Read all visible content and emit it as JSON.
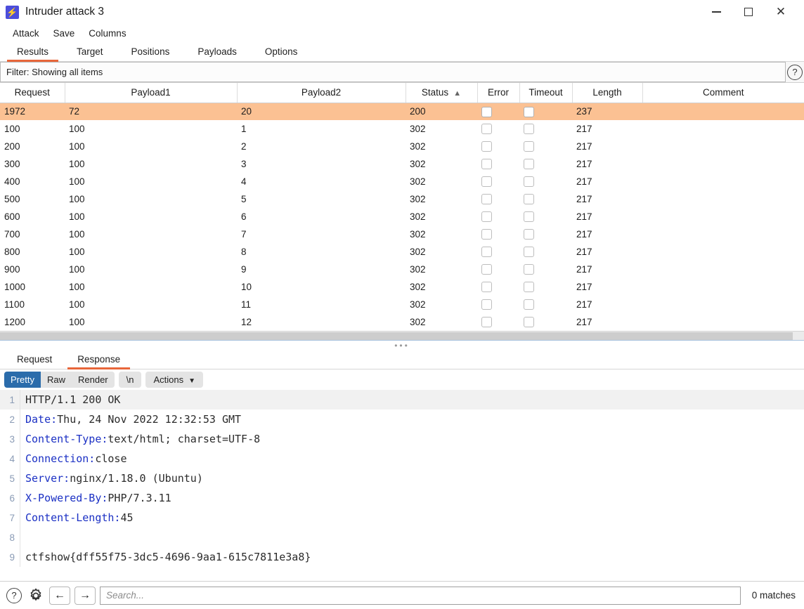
{
  "window": {
    "title": "Intruder attack 3",
    "app_icon": "lightning-bolt-icon",
    "minimize": "minimize-icon",
    "maximize": "maximize-icon",
    "close": "close-icon"
  },
  "menubar": {
    "items": [
      "Attack",
      "Save",
      "Columns"
    ]
  },
  "tabs": {
    "items": [
      "Results",
      "Target",
      "Positions",
      "Payloads",
      "Options"
    ],
    "active": "Results"
  },
  "filter": {
    "text": "Filter: Showing all items",
    "help_icon": "question-circle-icon"
  },
  "table": {
    "columns": [
      "Request",
      "Payload1",
      "Payload2",
      "Status",
      "Error",
      "Timeout",
      "Length",
      "Comment"
    ],
    "sorted_column": "Status",
    "sort_direction": "ascending",
    "rows": [
      {
        "request": "1972",
        "payload1": "72",
        "payload2": "20",
        "status": "200",
        "error": false,
        "timeout": false,
        "length": "237",
        "comment": "",
        "selected": true
      },
      {
        "request": "100",
        "payload1": "100",
        "payload2": "1",
        "status": "302",
        "error": false,
        "timeout": false,
        "length": "217",
        "comment": "",
        "selected": false
      },
      {
        "request": "200",
        "payload1": "100",
        "payload2": "2",
        "status": "302",
        "error": false,
        "timeout": false,
        "length": "217",
        "comment": "",
        "selected": false
      },
      {
        "request": "300",
        "payload1": "100",
        "payload2": "3",
        "status": "302",
        "error": false,
        "timeout": false,
        "length": "217",
        "comment": "",
        "selected": false
      },
      {
        "request": "400",
        "payload1": "100",
        "payload2": "4",
        "status": "302",
        "error": false,
        "timeout": false,
        "length": "217",
        "comment": "",
        "selected": false
      },
      {
        "request": "500",
        "payload1": "100",
        "payload2": "5",
        "status": "302",
        "error": false,
        "timeout": false,
        "length": "217",
        "comment": "",
        "selected": false
      },
      {
        "request": "600",
        "payload1": "100",
        "payload2": "6",
        "status": "302",
        "error": false,
        "timeout": false,
        "length": "217",
        "comment": "",
        "selected": false
      },
      {
        "request": "700",
        "payload1": "100",
        "payload2": "7",
        "status": "302",
        "error": false,
        "timeout": false,
        "length": "217",
        "comment": "",
        "selected": false
      },
      {
        "request": "800",
        "payload1": "100",
        "payload2": "8",
        "status": "302",
        "error": false,
        "timeout": false,
        "length": "217",
        "comment": "",
        "selected": false
      },
      {
        "request": "900",
        "payload1": "100",
        "payload2": "9",
        "status": "302",
        "error": false,
        "timeout": false,
        "length": "217",
        "comment": "",
        "selected": false
      },
      {
        "request": "1000",
        "payload1": "100",
        "payload2": "10",
        "status": "302",
        "error": false,
        "timeout": false,
        "length": "217",
        "comment": "",
        "selected": false
      },
      {
        "request": "1100",
        "payload1": "100",
        "payload2": "11",
        "status": "302",
        "error": false,
        "timeout": false,
        "length": "217",
        "comment": "",
        "selected": false
      },
      {
        "request": "1200",
        "payload1": "100",
        "payload2": "12",
        "status": "302",
        "error": false,
        "timeout": false,
        "length": "217",
        "comment": "",
        "selected": false
      }
    ]
  },
  "detail": {
    "tabs": [
      "Request",
      "Response"
    ],
    "active_tab": "Response",
    "viewbar": {
      "segments": [
        "Pretty",
        "Raw",
        "Render"
      ],
      "active_segment": "Pretty",
      "newline_label": "\\n",
      "actions_label": "Actions",
      "actions_caret": "chevron-down-icon"
    },
    "response_lines": [
      {
        "n": "1",
        "name": "",
        "value": "HTTP/1.1 200 OK"
      },
      {
        "n": "2",
        "name": "Date:",
        "value": " Thu, 24 Nov 2022 12:32:53 GMT"
      },
      {
        "n": "3",
        "name": "Content-Type:",
        "value": " text/html; charset=UTF-8"
      },
      {
        "n": "4",
        "name": "Connection:",
        "value": " close"
      },
      {
        "n": "5",
        "name": "Server:",
        "value": " nginx/1.18.0 (Ubuntu)"
      },
      {
        "n": "6",
        "name": "X-Powered-By:",
        "value": " PHP/7.3.11"
      },
      {
        "n": "7",
        "name": "Content-Length:",
        "value": " 45"
      },
      {
        "n": "8",
        "name": "",
        "value": ""
      },
      {
        "n": "9",
        "name": "",
        "value": "ctfshow{dff55f75-3dc5-4696-9aa1-615c7811e3a8}"
      }
    ]
  },
  "statusbar": {
    "help_icon": "question-circle-icon",
    "settings_icon": "gear-icon",
    "prev_icon": "arrow-left-icon",
    "next_icon": "arrow-right-icon",
    "search_placeholder": "Search...",
    "search_value": "",
    "matches": "0 matches"
  },
  "colors": {
    "accent": "#e8663a",
    "selected_row": "#fbc193",
    "active_segment": "#2b6cab",
    "header_name": "#1b30c4",
    "app_icon": "#4b4ddb"
  }
}
